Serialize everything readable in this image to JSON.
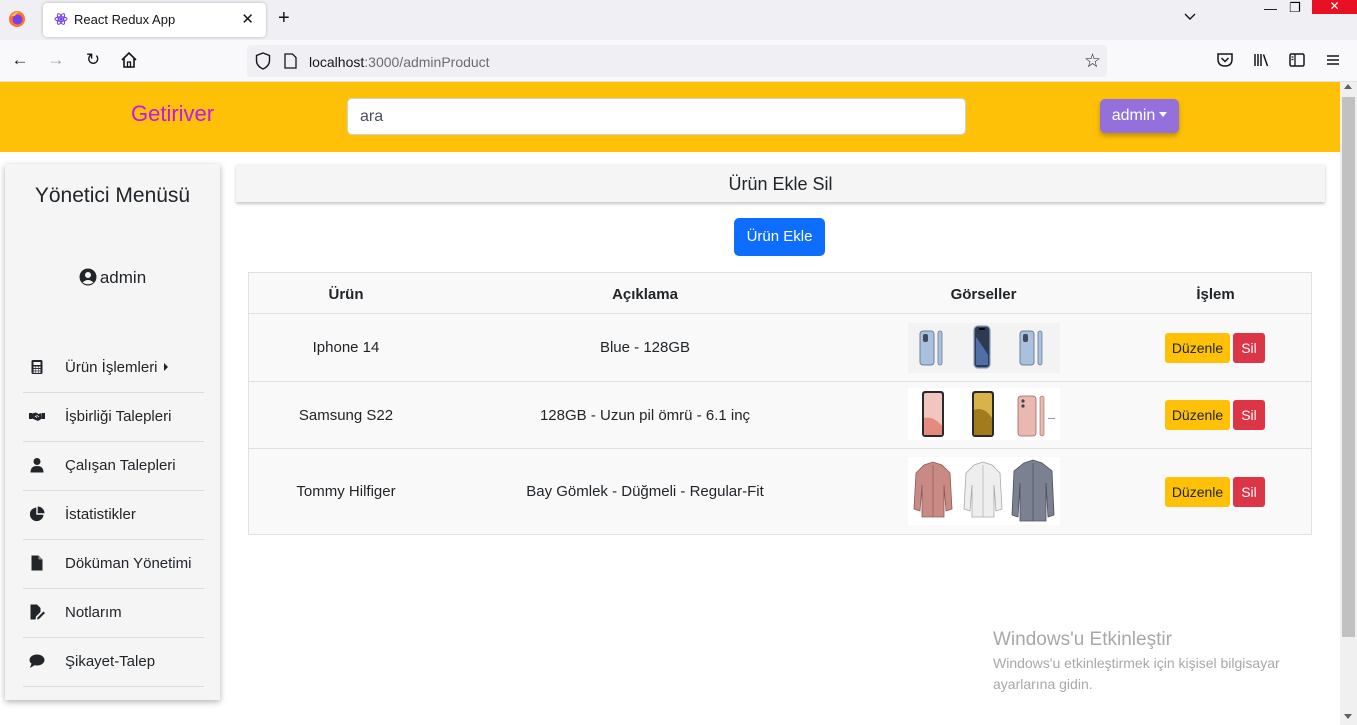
{
  "browser": {
    "tab_title": "React Redux App",
    "url_host": "localhost",
    "url_rest": ":3000/adminProduct"
  },
  "header": {
    "brand": "Getiriver",
    "search_value": "ara",
    "user_button": "admin"
  },
  "sidebar": {
    "title": "Yönetici Menüsü",
    "user": "admin",
    "items": [
      {
        "label": "Ürün İşlemleri",
        "icon": "calculator-icon"
      },
      {
        "label": "İşbirliği Talepleri",
        "icon": "handshake-icon"
      },
      {
        "label": "Çalışan Talepleri",
        "icon": "user-icon"
      },
      {
        "label": "İstatistikler",
        "icon": "pie-chart-icon"
      },
      {
        "label": "Döküman Yönetimi",
        "icon": "file-icon"
      },
      {
        "label": "Notlarım",
        "icon": "note-edit-icon"
      },
      {
        "label": "Şikayet-Talep",
        "icon": "comment-icon"
      }
    ]
  },
  "main": {
    "page_title": "Ürün Ekle Sil",
    "add_button": "Ürün Ekle",
    "columns": [
      "Ürün",
      "Açıklama",
      "Görseller",
      "İşlem"
    ],
    "rows": [
      {
        "product": "Iphone 14",
        "description": "Blue - 128GB"
      },
      {
        "product": "Samsung S22",
        "description": "128GB - Uzun pil ömrü - 6.1 inç"
      },
      {
        "product": "Tommy Hilfiger",
        "description": "Bay Gömlek - Düğmeli - Regular-Fit"
      }
    ],
    "edit_label": "Düzenle",
    "delete_label": "Sil"
  },
  "watermark": {
    "title": "Windows'u Etkinleştir",
    "line1": "Windows'u etkinleştirmek için kişisel bilgisayar",
    "line2": "ayarlarına gidin."
  },
  "colors": {
    "header_bg": "#ffc107",
    "brand": "#c217ee",
    "user_button": "#9370db",
    "primary": "#0d6efd",
    "danger": "#dc3545"
  }
}
